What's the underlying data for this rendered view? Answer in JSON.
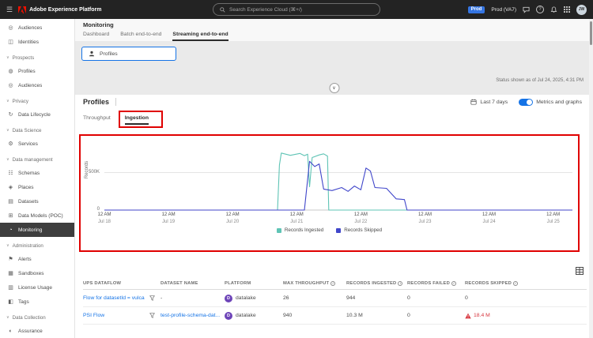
{
  "topbar": {
    "title": "Adobe Experience Platform",
    "search_placeholder": "Search Experience Cloud (⌘+/)",
    "env_badge": "Prod",
    "env_name": "Prod (VA7)",
    "avatar_initials": "JW"
  },
  "sidebar": {
    "items": [
      {
        "label": "Audiences",
        "type": "item",
        "icon": "audiences-icon"
      },
      {
        "label": "Identities",
        "type": "item",
        "icon": "identities-icon"
      },
      {
        "label": "Prospects",
        "type": "section",
        "icon": "chevron-down-icon"
      },
      {
        "label": "Profiles",
        "type": "item",
        "icon": "profiles-icon"
      },
      {
        "label": "Audiences",
        "type": "item",
        "icon": "audiences-icon"
      },
      {
        "label": "Privacy",
        "type": "section",
        "icon": "chevron-down-icon"
      },
      {
        "label": "Data Lifecycle",
        "type": "item",
        "icon": "data-lifecycle-icon"
      },
      {
        "label": "Data Science",
        "type": "section",
        "icon": "chevron-down-icon"
      },
      {
        "label": "Services",
        "type": "item",
        "icon": "services-icon"
      },
      {
        "label": "Data management",
        "type": "section",
        "icon": "chevron-down-icon"
      },
      {
        "label": "Schemas",
        "type": "item",
        "icon": "schemas-icon"
      },
      {
        "label": "Places",
        "type": "item",
        "icon": "places-icon"
      },
      {
        "label": "Datasets",
        "type": "item",
        "icon": "datasets-icon"
      },
      {
        "label": "Data Models (POC)",
        "type": "item",
        "icon": "data-models-icon"
      },
      {
        "label": "Monitoring",
        "type": "item",
        "icon": "monitoring-icon",
        "selected": true
      },
      {
        "label": "Administration",
        "type": "section",
        "icon": "chevron-down-icon"
      },
      {
        "label": "Alerts",
        "type": "item",
        "icon": "alerts-icon"
      },
      {
        "label": "Sandboxes",
        "type": "item",
        "icon": "sandboxes-icon"
      },
      {
        "label": "License Usage",
        "type": "item",
        "icon": "license-usage-icon"
      },
      {
        "label": "Tags",
        "type": "item",
        "icon": "tags-icon"
      },
      {
        "label": "Data Collection",
        "type": "section",
        "icon": "chevron-down-icon"
      },
      {
        "label": "Assurance",
        "type": "item",
        "icon": "assurance-icon"
      }
    ]
  },
  "page": {
    "title": "Monitoring",
    "tabs": [
      {
        "label": "Dashboard"
      },
      {
        "label": "Batch end-to-end"
      },
      {
        "label": "Streaming end-to-end"
      }
    ],
    "active_tab": "Streaming end-to-end",
    "filter_chip_label": "Profiles",
    "status_text": "Status shown as of Jul 24, 2025, 4:31 PM"
  },
  "profiles": {
    "title": "Profiles",
    "date_range": "Last 7 days",
    "toggle_label": "Metrics and graphs",
    "toggle_on": true,
    "tabs": [
      {
        "label": "Throughput"
      },
      {
        "label": "Ingestion"
      }
    ],
    "active_tab": "Ingestion"
  },
  "chart_data": {
    "type": "line",
    "title": "",
    "xlabel": "",
    "ylabel": "Records",
    "ylim": [
      0,
      800000
    ],
    "x_range_days": [
      0,
      7.3
    ],
    "grid": "horizontal",
    "legend_position": "bottom",
    "yticks": [
      {
        "value": 500000,
        "label": "500K"
      },
      {
        "value": 0,
        "label": "0"
      }
    ],
    "x_ticks": [
      {
        "time": "12 AM",
        "date": "Jul 18"
      },
      {
        "time": "12 AM",
        "date": "Jul 19"
      },
      {
        "time": "12 AM",
        "date": "Jul 20"
      },
      {
        "time": "12 AM",
        "date": "Jul 21"
      },
      {
        "time": "12 AM",
        "date": "Jul 22"
      },
      {
        "time": "12 AM",
        "date": "Jul 23"
      },
      {
        "time": "12 AM",
        "date": "Jul 24"
      },
      {
        "time": "12 AM",
        "date": "Jul 25"
      }
    ],
    "series": [
      {
        "name": "Records Ingested",
        "color": "#5fc4b5",
        "points": [
          [
            0,
            0
          ],
          [
            2.7,
            0
          ],
          [
            2.73,
            600000
          ],
          [
            2.76,
            760000
          ],
          [
            2.9,
            730000
          ],
          [
            3.05,
            755000
          ],
          [
            3.12,
            725000
          ],
          [
            3.17,
            745000
          ],
          [
            3.2,
            310000
          ],
          [
            3.24,
            700000
          ],
          [
            3.35,
            735000
          ],
          [
            3.42,
            750000
          ],
          [
            3.48,
            720000
          ],
          [
            3.5,
            0
          ],
          [
            7.3,
            0
          ]
        ]
      },
      {
        "name": "Records Skipped",
        "color": "#4046ca",
        "points": [
          [
            0,
            0
          ],
          [
            3.12,
            0
          ],
          [
            3.2,
            650000
          ],
          [
            3.28,
            580000
          ],
          [
            3.35,
            615000
          ],
          [
            3.42,
            280000
          ],
          [
            3.55,
            260000
          ],
          [
            3.7,
            300000
          ],
          [
            3.8,
            250000
          ],
          [
            3.9,
            320000
          ],
          [
            4.0,
            270000
          ],
          [
            4.08,
            560000
          ],
          [
            4.15,
            520000
          ],
          [
            4.22,
            300000
          ],
          [
            4.4,
            290000
          ],
          [
            4.55,
            150000
          ],
          [
            4.68,
            140000
          ],
          [
            4.72,
            0
          ],
          [
            7.3,
            0
          ]
        ]
      }
    ]
  },
  "table": {
    "columns": [
      {
        "label": "UPS DATAFLOW",
        "info": false
      },
      {
        "label": "",
        "info": false
      },
      {
        "label": "DATASET NAME",
        "info": false
      },
      {
        "label": "PLATFORM",
        "info": false
      },
      {
        "label": "MAX THROUGHPUT",
        "info": true
      },
      {
        "label": "RECORDS INGESTED",
        "info": true
      },
      {
        "label": "RECORDS FAILED",
        "info": true
      },
      {
        "label": "RECORDS SKIPPED",
        "info": true
      }
    ],
    "rows": [
      {
        "dataflow": "Flow for datasetId = vulca",
        "dataset": "-",
        "platform": "datalake",
        "platform_initial": "D",
        "max_throughput": "26",
        "records_ingested": "944",
        "records_failed": "0",
        "records_skipped": "0",
        "skipped_warning": false
      },
      {
        "dataflow": "PSI Flow",
        "dataset": "test-profile-schema-dat...",
        "platform": "datalake",
        "platform_initial": "D",
        "max_throughput": "940",
        "records_ingested": "10.3 M",
        "records_failed": "0",
        "records_skipped": "18.4 M",
        "skipped_warning": true
      }
    ]
  },
  "colors": {
    "annotation_red": "#e00000",
    "accent_blue": "#1473e6",
    "link_blue": "#1473e6",
    "warning_red": "#d7373f",
    "platform_purple": "#6d44b8",
    "series_teal": "#5fc4b5",
    "series_indigo": "#4046ca"
  }
}
